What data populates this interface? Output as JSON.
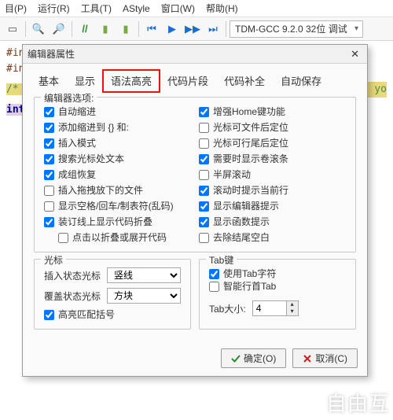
{
  "menu": [
    "目(P)",
    "运行(R)",
    "工具(T)",
    "AStyle",
    "窗口(W)",
    "帮助(H)"
  ],
  "compiler": "TDM-GCC 9.2.0 32位 调试",
  "code": {
    "inc1": "#inc",
    "inc2": "#inc",
    "cm": "/* r",
    "kw": "int",
    "tail": "dd yo"
  },
  "dialog": {
    "title": "编辑器属性",
    "tabs": [
      "基本",
      "显示",
      "语法高亮",
      "代码片段",
      "代码补全",
      "自动保存"
    ],
    "editorOptions": "编辑器选项:",
    "left": [
      {
        "l": "自动缩进",
        "c": true
      },
      {
        "l": "添加缩进到 {} 和:",
        "c": true
      },
      {
        "l": "插入模式",
        "c": true
      },
      {
        "l": "搜索光标处文本",
        "c": true
      },
      {
        "l": "成组恢复",
        "c": true
      },
      {
        "l": "插入拖拽放下的文件",
        "c": false
      },
      {
        "l": "显示空格/回车/制表符(乱码)",
        "c": false
      },
      {
        "l": "装订线上显示代码折叠",
        "c": true
      },
      {
        "l": "点击以折叠或展开代码",
        "c": false,
        "indent": true
      }
    ],
    "right": [
      {
        "l": "增强Home键功能",
        "c": true
      },
      {
        "l": "光标可文件后定位",
        "c": false
      },
      {
        "l": "光标可行尾后定位",
        "c": false
      },
      {
        "l": "需要时显示卷滚条",
        "c": true
      },
      {
        "l": "半屏滚动",
        "c": false
      },
      {
        "l": "滚动时提示当前行",
        "c": true
      },
      {
        "l": "显示编辑器提示",
        "c": true
      },
      {
        "l": "显示函数提示",
        "c": true
      },
      {
        "l": "去除结尾空白",
        "c": false
      }
    ],
    "cursorGroup": "光标",
    "insertCaret": "插入状态光标",
    "overCaret": "覆盖状态光标",
    "insertSel": "竖线",
    "overSel": "方块",
    "highlightMatch": "高亮匹配括号",
    "tabGroup": "Tab键",
    "useTab": "使用Tab字符",
    "smartTab": "智能行首Tab",
    "tabSizeLbl": "Tab大小:",
    "tabSize": "4",
    "ok": "确定(O)",
    "cancel": "取消(C)"
  },
  "watermark": "自由互"
}
